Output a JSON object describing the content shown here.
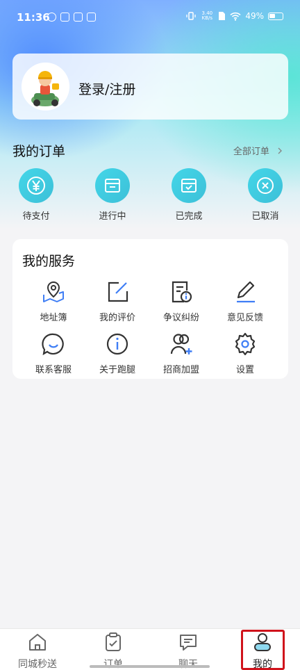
{
  "status_bar": {
    "time": "11:36",
    "net_speed_value": "3.40",
    "net_speed_unit": "KB/s",
    "battery": "49%"
  },
  "profile": {
    "login_label": "登录/注册"
  },
  "orders": {
    "title": "我的订单",
    "all_link": "全部订单",
    "items": [
      {
        "label": "待支付",
        "icon": "yen-icon"
      },
      {
        "label": "进行中",
        "icon": "box-icon"
      },
      {
        "label": "已完成",
        "icon": "box-check-icon"
      },
      {
        "label": "已取消",
        "icon": "cancel-icon"
      }
    ]
  },
  "services": {
    "title": "我的服务",
    "items": [
      {
        "label": "地址簿",
        "icon": "map-pin-icon"
      },
      {
        "label": "我的评价",
        "icon": "edit-box-icon"
      },
      {
        "label": "争议纠纷",
        "icon": "document-info-icon"
      },
      {
        "label": "意见反馈",
        "icon": "pencil-icon"
      },
      {
        "label": "联系客服",
        "icon": "chat-smile-icon"
      },
      {
        "label": "关于跑腿",
        "icon": "info-icon"
      },
      {
        "label": "招商加盟",
        "icon": "add-user-icon"
      },
      {
        "label": "设置",
        "icon": "settings-icon"
      }
    ]
  },
  "tab_bar": {
    "items": [
      {
        "label": "同城秒送",
        "icon": "home-icon",
        "active": false
      },
      {
        "label": "订单",
        "icon": "clipboard-check-icon",
        "active": false
      },
      {
        "label": "聊天",
        "icon": "chat-icon",
        "active": false
      },
      {
        "label": "我的",
        "icon": "user-icon",
        "active": true
      }
    ]
  },
  "colors": {
    "accent": "#3dc0d8",
    "icon_blue": "#3f7ef5",
    "highlight": "#d0121b"
  }
}
